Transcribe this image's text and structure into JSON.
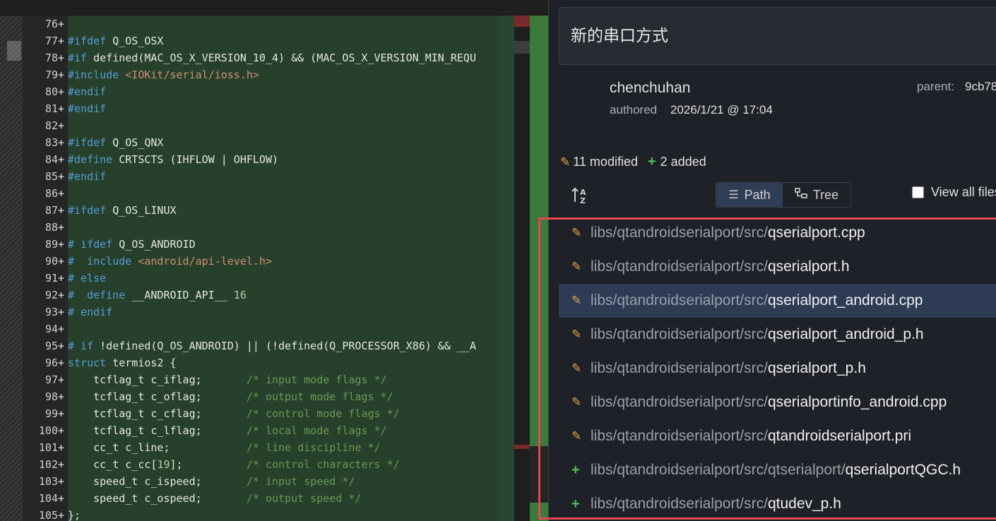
{
  "editor": {
    "lines": [
      {
        "num": "76",
        "code": ""
      },
      {
        "num": "77",
        "code": "#ifdef Q_OS_OSX"
      },
      {
        "num": "78",
        "code": "#if defined(MAC_OS_X_VERSION_10_4) && (MAC_OS_X_VERSION_MIN_REQU"
      },
      {
        "num": "79",
        "code": "#include <IOKit/serial/ioss.h>"
      },
      {
        "num": "80",
        "code": "#endif"
      },
      {
        "num": "81",
        "code": "#endif"
      },
      {
        "num": "82",
        "code": ""
      },
      {
        "num": "83",
        "code": "#ifdef Q_OS_QNX"
      },
      {
        "num": "84",
        "code": "#define CRTSCTS (IHFLOW | OHFLOW)"
      },
      {
        "num": "85",
        "code": "#endif"
      },
      {
        "num": "86",
        "code": ""
      },
      {
        "num": "87",
        "code": "#ifdef Q_OS_LINUX"
      },
      {
        "num": "88",
        "code": ""
      },
      {
        "num": "89",
        "code": "# ifdef Q_OS_ANDROID"
      },
      {
        "num": "90",
        "code": "#  include <android/api-level.h>"
      },
      {
        "num": "91",
        "code": "# else"
      },
      {
        "num": "92",
        "code": "#  define __ANDROID_API__ 16"
      },
      {
        "num": "93",
        "code": "# endif"
      },
      {
        "num": "94",
        "code": ""
      },
      {
        "num": "95",
        "code": "# if !defined(Q_OS_ANDROID) || (!defined(Q_PROCESSOR_X86) && __A"
      },
      {
        "num": "96",
        "code": "struct termios2 {"
      },
      {
        "num": "97",
        "code": "    tcflag_t c_iflag;       /* input mode flags */"
      },
      {
        "num": "98",
        "code": "    tcflag_t c_oflag;       /* output mode flags */"
      },
      {
        "num": "99",
        "code": "    tcflag_t c_cflag;       /* control mode flags */"
      },
      {
        "num": "100",
        "code": "    tcflag_t c_lflag;       /* local mode flags */"
      },
      {
        "num": "101",
        "code": "    cc_t c_line;            /* line discipline */"
      },
      {
        "num": "102",
        "code": "    cc_t c_cc[19];          /* control characters */"
      },
      {
        "num": "103",
        "code": "    speed_t c_ispeed;       /* input speed */"
      },
      {
        "num": "104",
        "code": "    speed_t c_ospeed;       /* output speed */"
      },
      {
        "num": "105",
        "code": "};"
      }
    ]
  },
  "commit": {
    "summary": "新的串口方式",
    "author": "chenchuhan",
    "authored_label": "authored",
    "authored_date": "2026/1/21 @ 17:04",
    "parent_label": "parent:",
    "parent_hash": "9cb78",
    "stats": {
      "modified": "11 modified",
      "added": "2 added"
    },
    "view": {
      "path_label": "Path",
      "tree_label": "Tree",
      "view_all_label": "View all files"
    },
    "files": [
      {
        "status": "modified",
        "dir": "libs/qtandroidserialport/src/",
        "name": "qserialport.cpp"
      },
      {
        "status": "modified",
        "dir": "libs/qtandroidserialport/src/",
        "name": "qserialport.h"
      },
      {
        "status": "modified",
        "dir": "libs/qtandroidserialport/src/",
        "name": "qserialport_android.cpp",
        "selected": true
      },
      {
        "status": "modified",
        "dir": "libs/qtandroidserialport/src/",
        "name": "qserialport_android_p.h"
      },
      {
        "status": "modified",
        "dir": "libs/qtandroidserialport/src/",
        "name": "qserialport_p.h"
      },
      {
        "status": "modified",
        "dir": "libs/qtandroidserialport/src/",
        "name": "qserialportinfo_android.cpp"
      },
      {
        "status": "modified",
        "dir": "libs/qtandroidserialport/src/",
        "name": "qtandroidserialport.pri"
      },
      {
        "status": "added",
        "dir": "libs/qtandroidserialport/src/qtserialport/",
        "name": "qserialportQGC.h"
      },
      {
        "status": "added",
        "dir": "libs/qtandroidserialport/src/",
        "name": "qtudev_p.h"
      }
    ]
  },
  "icons": {
    "modified": "pencil-icon",
    "added": "plus-icon",
    "sort": "sort-alpha-icon",
    "path": "list-icon",
    "tree": "tree-icon"
  },
  "colors": {
    "added_bg": "#26402b",
    "modified": "#e3a54a",
    "added": "#4fbf5a",
    "selection": "#2d3b55",
    "highlight": "#e5484d"
  }
}
